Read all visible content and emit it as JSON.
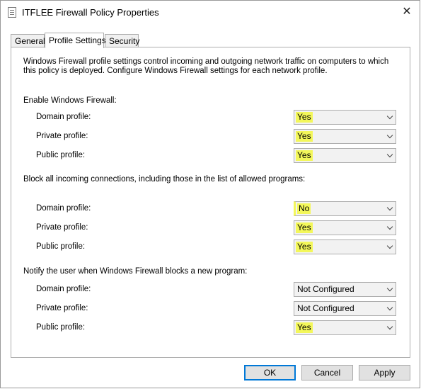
{
  "window": {
    "title": "ITFLEE Firewall Policy Properties",
    "close_glyph": "✕"
  },
  "tabs": [
    {
      "label": "General",
      "active": false
    },
    {
      "label": "Profile Settings",
      "active": true
    },
    {
      "label": "Security",
      "active": false
    }
  ],
  "description": "Windows Firewall profile settings control incoming and outgoing network traffic on computers to which this policy is deployed. Configure Windows Firewall settings for each network profile.",
  "sections": [
    {
      "heading": "Enable Windows Firewall:",
      "rows": [
        {
          "label": "Domain profile:",
          "value": "Yes",
          "highlighted": true
        },
        {
          "label": "Private profile:",
          "value": "Yes",
          "highlighted": true
        },
        {
          "label": "Public profile:",
          "value": "Yes",
          "highlighted": true
        }
      ]
    },
    {
      "heading": "Block all incoming connections, including those in the list of allowed programs:",
      "rows": [
        {
          "label": "Domain profile:",
          "value": "No",
          "highlighted": true
        },
        {
          "label": "Private profile:",
          "value": "Yes",
          "highlighted": true
        },
        {
          "label": "Public profile:",
          "value": "Yes",
          "highlighted": true
        }
      ]
    },
    {
      "heading": "Notify the user when Windows Firewall blocks a new program:",
      "rows": [
        {
          "label": "Domain profile:",
          "value": "Not Configured",
          "highlighted": false
        },
        {
          "label": "Private profile:",
          "value": "Not Configured",
          "highlighted": false
        },
        {
          "label": "Public profile:",
          "value": "Yes",
          "highlighted": true
        }
      ]
    }
  ],
  "highlight_color": "#f3f75a",
  "buttons": {
    "ok": "OK",
    "cancel": "Cancel",
    "apply": "Apply"
  }
}
